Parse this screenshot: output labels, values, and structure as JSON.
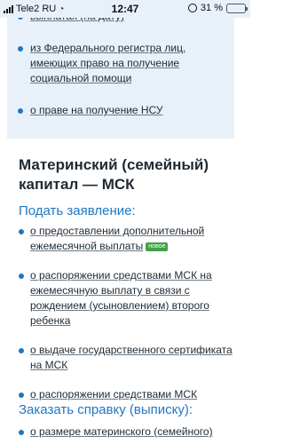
{
  "status_bar": {
    "carrier": "Tele2 RU",
    "time": "12:47",
    "battery_percent": "31 %",
    "battery_level": 0.31
  },
  "top_block": {
    "items": [
      {
        "label": "выплатах (на дату)"
      },
      {
        "label": "из Федерального регистра лиц, имеющих право на получение социальной помощи"
      },
      {
        "label": "о праве на получение НСУ"
      }
    ]
  },
  "section": {
    "title": "Материнский (семейный) капитал — МСК",
    "apply_heading": "Подать заявление:",
    "apply_items": [
      {
        "label": "о предоставлении дополнительной ежемесячной выплаты",
        "badge": "новое"
      },
      {
        "label": "о распоряжении средствами МСК на ежемесячную выплату в связи с рождением (усыновлением) второго ребенка"
      },
      {
        "label": "о выдаче государственного сертификата на МСК"
      },
      {
        "label": "о распоряжении средствами МСК"
      }
    ],
    "order_heading": "Заказать справку (выписку):",
    "order_items": [
      {
        "label": "о размере материнского (семейного)"
      }
    ]
  },
  "colors": {
    "accent": "#1f77c4",
    "panel_bg": "#e8f1f9",
    "badge_bg": "#43a047",
    "battery": "#f2c200"
  }
}
